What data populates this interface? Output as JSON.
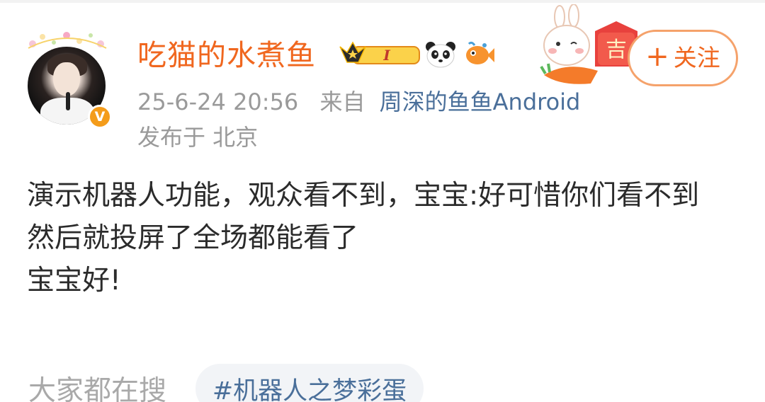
{
  "author": {
    "name": "吃猫的水煮鱼",
    "verified_badge": "V",
    "level_badge_text": "I"
  },
  "post_meta": {
    "time": "25-6-24 20:56",
    "source_prefix": "来自",
    "source": "周深的鱼鱼Android",
    "location": "发布于 北京"
  },
  "follow_button": {
    "icon": "+",
    "label": "关注"
  },
  "decor": {
    "ji_char": "吉"
  },
  "post_content": {
    "lines": [
      "演示机器人功能，观众看不到，宝宝:好可惜你们看不到",
      "然后就投屏了全场都能看了",
      "宝宝好!"
    ]
  },
  "search": {
    "label": "大家都在搜",
    "hashtag": "#机器人之梦彩蛋"
  },
  "colors": {
    "name_orange": "#f0671f",
    "link_blue": "#4a6f9a",
    "meta_gray": "#9a9a9a",
    "badge_orange": "#f49c1a"
  },
  "icons": [
    "avatar-frame-icon",
    "crown-level-icon",
    "panda-icon",
    "fish-icon",
    "rabbit-decor-icon",
    "verified-icon"
  ]
}
